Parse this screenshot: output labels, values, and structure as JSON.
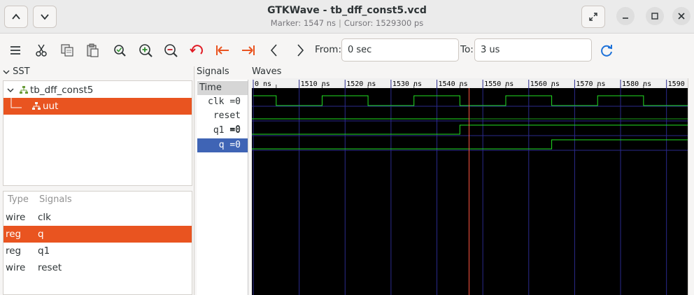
{
  "window": {
    "title": "GTKWave - tb_dff_const5.vcd",
    "marker_text": "Marker: 1547 ns",
    "cursor_text": "Cursor: 1529300 ps"
  },
  "toolbar": {
    "from_label": "From:",
    "from_value": "0 sec",
    "to_label": "To:",
    "to_value": "3 us"
  },
  "sst": {
    "label": "SST",
    "tree": [
      {
        "label": "tb_dff_const5",
        "icon": "module-icon"
      },
      {
        "label": "uut",
        "icon": "module-icon"
      }
    ]
  },
  "signal_list": {
    "headers": {
      "type": "Type",
      "signals": "Signals"
    },
    "rows": [
      {
        "type": "wire",
        "name": "clk"
      },
      {
        "type": "reg",
        "name": "q"
      },
      {
        "type": "reg",
        "name": "q1"
      },
      {
        "type": "wire",
        "name": "reset"
      }
    ]
  },
  "signals_pane": {
    "label": "Signals",
    "time_label": "Time",
    "rows": [
      "clk =0",
      "reset =0",
      "q1 =0",
      "q =0"
    ]
  },
  "waves": {
    "label": "Waves",
    "tick_labels": [
      "0 ns",
      "1510 ns",
      "1520 ns",
      "1530 ns",
      "1540 ns",
      "1550 ns",
      "1560 ns",
      "1570 ns",
      "1580 ns",
      "1590 ns"
    ],
    "view_start_ns": 1500,
    "view_end_ns": 1595,
    "marker_ns": 1547,
    "colors": {
      "background": "#000000",
      "grid": "#2a2a8c",
      "trace": "#22e022",
      "low": "#1c9e1c",
      "marker": "#ff5540",
      "unknown": "#2a2a8c"
    }
  }
}
